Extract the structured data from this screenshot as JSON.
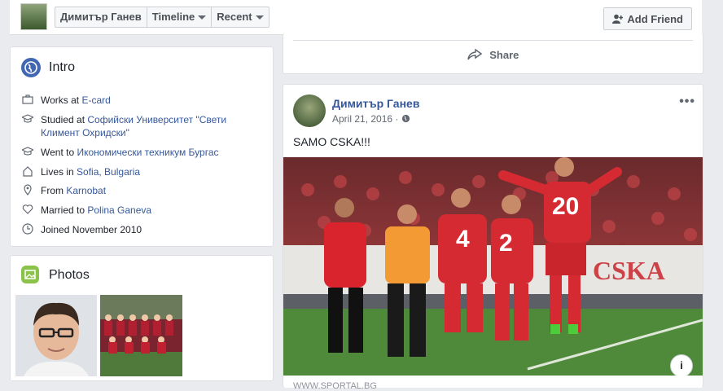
{
  "header": {
    "name_button": "Димитър Ганев",
    "timeline_button": "Timeline",
    "recent_button": "Recent",
    "add_friend_button": "Add Friend"
  },
  "intro": {
    "title": "Intro",
    "items": [
      {
        "icon": "briefcase-icon",
        "prefix": "Works at ",
        "link": "E-card",
        "suffix": "",
        "link2": ""
      },
      {
        "icon": "graduation-cap-icon",
        "prefix": "Studied at ",
        "link": "Софийски Университет \"Свети Климент Охридски\"",
        "suffix": "",
        "link2": ""
      },
      {
        "icon": "graduation-cap-icon",
        "prefix": "Went to ",
        "link": "Икономически техникум Бургас",
        "suffix": "",
        "link2": ""
      },
      {
        "icon": "home-icon",
        "prefix": "Lives in ",
        "link": "Sofia, Bulgaria",
        "suffix": "",
        "link2": ""
      },
      {
        "icon": "location-pin-icon",
        "prefix": "From ",
        "link": "Karnobat",
        "suffix": "",
        "link2": ""
      },
      {
        "icon": "heart-icon",
        "prefix": "Married to ",
        "link": "Polina Ganeva",
        "suffix": "",
        "link2": ""
      },
      {
        "icon": "clock-icon",
        "prefix": "Joined November 2010",
        "link": "",
        "suffix": "",
        "link2": ""
      }
    ]
  },
  "photos": {
    "title": "Photos"
  },
  "share": {
    "label": "Share"
  },
  "post": {
    "author": "Димитър Ганев",
    "date": "April 21, 2016 · ",
    "text": "SAMO CSKA!!!",
    "image_texts": {
      "jersey_left": "4",
      "jersey_mid": "2",
      "jersey_right": "20",
      "banner": "CSKA"
    },
    "caption": "WWW.SPORTAL.BG"
  },
  "colors": {
    "link": "#365899",
    "background": "#e9ebee",
    "intro_icon": "#4267b2",
    "photos_icon": "#8bc34a"
  }
}
